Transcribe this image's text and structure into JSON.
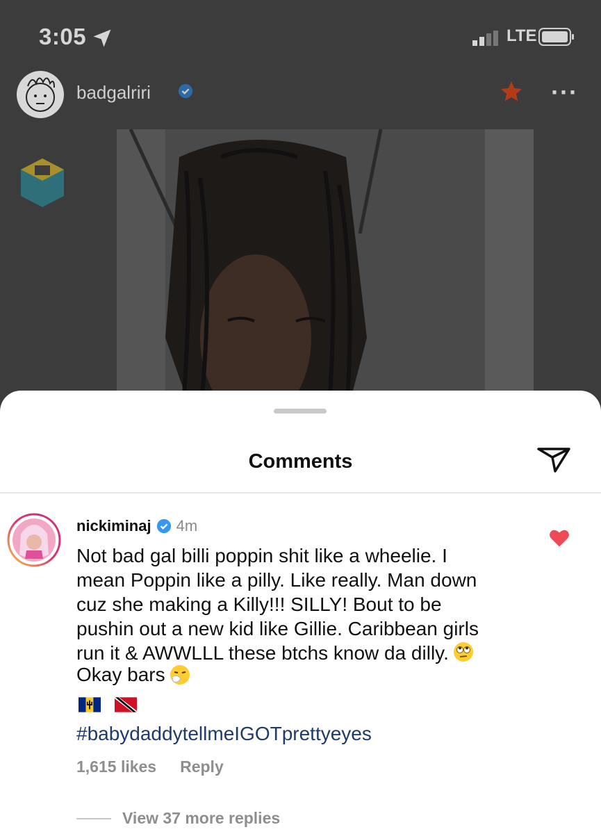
{
  "status_bar": {
    "time": "3:05",
    "network": "LTE"
  },
  "post": {
    "username": "badgalriri"
  },
  "comments_sheet": {
    "title": "Comments",
    "comment": {
      "username": "nickiminaj",
      "time_ago": "4m",
      "lines": [
        "Not bad gal billi poppin shit like a wheelie. I",
        "mean Poppin like a pilly. Like really. Man down",
        "cuz she making a Killy!!! SILLY! Bout to be",
        "pushin out a new kid like Gillie. Caribbean girls",
        "run it & AWWLLL these btchs know da dilly."
      ],
      "second_line": "Okay bars",
      "hashtag": "#babydaddytellmeIGOTprettyeyes",
      "likes": "1,615 likes",
      "reply_label": "Reply",
      "view_replies": "View 37 more replies"
    }
  },
  "icons": {
    "location": "location-arrow-icon",
    "star": "favorite-star-icon",
    "more": "more-dots-icon",
    "send": "send-icon",
    "heart": "liked-heart-icon",
    "verified": "verified-badge-icon"
  },
  "colors": {
    "heart": "#ed4956",
    "verified": "#3897f0",
    "hashtag": "#1f3a6b"
  }
}
